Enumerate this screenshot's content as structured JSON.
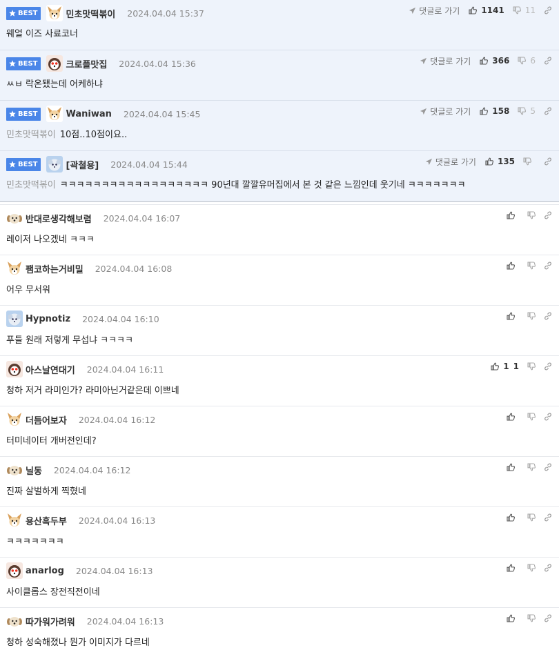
{
  "best_label": "BEST",
  "reply_label": "댓글로 가기",
  "best_comments": [
    {
      "nick": "민초맛떡볶이",
      "date": "2024.04.04 15:37",
      "reply_to": "",
      "text": "웨얼 이즈 사료코너",
      "up": "1141",
      "down": "11",
      "avatar": "dog-icon"
    },
    {
      "nick": "크로플맛집",
      "date": "2024.04.04 15:36",
      "reply_to": "",
      "text": "ㅆㅂ 락온됐는데 어케하냐",
      "up": "366",
      "down": "6",
      "avatar": "red-dog-icon"
    },
    {
      "nick": "Waniwan",
      "date": "2024.04.04 15:45",
      "reply_to": "민초맛떡볶이",
      "text": "10점..10점이요..",
      "up": "158",
      "down": "5",
      "avatar": "dog-icon"
    },
    {
      "nick": "[곽철용]",
      "date": "2024.04.04 15:44",
      "reply_to": "민초맛떡볶이",
      "text": "ㅋㅋㅋㅋㅋㅋㅋㅋㅋㅋㅋㅋㅋㅋㅋㅋㅋㅋ 90년대 깔깔유머집에서 본 것 같은 느낌인데 웃기네 ㅋㅋㅋㅋㅋㅋㅋ",
      "up": "135",
      "down": "",
      "avatar": "blue-dog-icon"
    }
  ],
  "comments": [
    {
      "nick": "반대로생각해보렴",
      "date": "2024.04.04 16:07",
      "text": "레이저 나오겠네 ㅋㅋㅋ",
      "up": "",
      "avatar": "puppy-icon"
    },
    {
      "nick": "팸코하는거비밀",
      "date": "2024.04.04 16:08",
      "text": "어우 무서워",
      "up": "",
      "avatar": "dog-icon"
    },
    {
      "nick": "Hypnotiz",
      "date": "2024.04.04 16:10",
      "text": "푸들 원래 저렇게 무섭냐 ㅋㅋㅋㅋ",
      "up": "",
      "avatar": "blue-dog-icon"
    },
    {
      "nick": "아스날연대기",
      "date": "2024.04.04 16:11",
      "text": "청하 저거 라미인가? 라미아닌거같은데 이쁘네",
      "up": "1",
      "avatar": "red-dog-icon"
    },
    {
      "nick": "더듬어보자",
      "date": "2024.04.04 16:12",
      "text": "터미네이터 개버전인데?",
      "up": "",
      "avatar": "dog-icon"
    },
    {
      "nick": "닐동",
      "date": "2024.04.04 16:12",
      "text": "진짜 살벌하게 찍혔네",
      "up": "",
      "avatar": "puppy-icon"
    },
    {
      "nick": "용산흑두부",
      "date": "2024.04.04 16:13",
      "text": "ㅋㅋㅋㅋㅋㅋㅋ",
      "up": "",
      "avatar": "dog-icon"
    },
    {
      "nick": "anarlog",
      "date": "2024.04.04 16:13",
      "text": "사이클롭스 장전직전이네",
      "up": "",
      "avatar": "red-dog-icon"
    },
    {
      "nick": "따가워가려워",
      "date": "2024.04.04 16:13",
      "text": "청하 성숙해졌나 뭔가 이미지가 다르네",
      "up": "",
      "avatar": "puppy-icon"
    }
  ]
}
